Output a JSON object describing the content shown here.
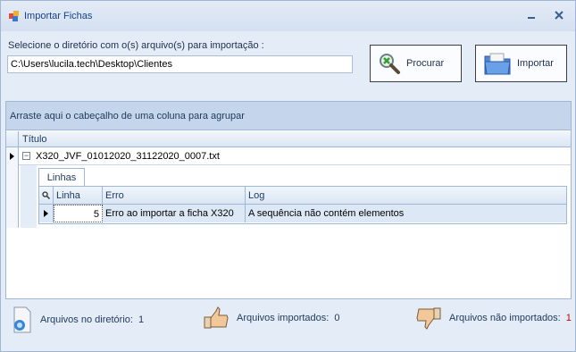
{
  "window": {
    "title": "Importar Fichas"
  },
  "directory": {
    "prompt": "Selecione o diretório com o(s) arquivo(s) para importação :",
    "path": "C:\\Users\\lucila.tech\\Desktop\\Clientes"
  },
  "buttons": {
    "procurar": "Procurar",
    "importar": "Importar"
  },
  "grid": {
    "group_panel_text": "Arraste aqui o cabeçalho de uma coluna para agrupar",
    "column_title": "Título",
    "master_row": "X320_JVF_01012020_31122020_0007.txt",
    "detail_tab": "Linhas",
    "detail_columns": {
      "linha": "Linha",
      "erro": "Erro",
      "log": "Log"
    },
    "detail_row": {
      "linha": "5",
      "erro": "Erro ao importar a ficha X320",
      "log": "A sequência não contém elementos"
    }
  },
  "status": {
    "dir_label": "Arquivos no diretório:",
    "dir_count": "1",
    "imported_label": "Arquivos importados:",
    "imported_count": "0",
    "not_imported_label": "Arquivos não importados:",
    "not_imported_count": "1"
  },
  "icons": {
    "app": "import-app-icon",
    "search": "magnifier-icon",
    "import": "folder-icon",
    "file": "document-icon",
    "thumbs_up": "thumbs-up-icon",
    "thumbs_down": "thumbs-down-icon"
  }
}
